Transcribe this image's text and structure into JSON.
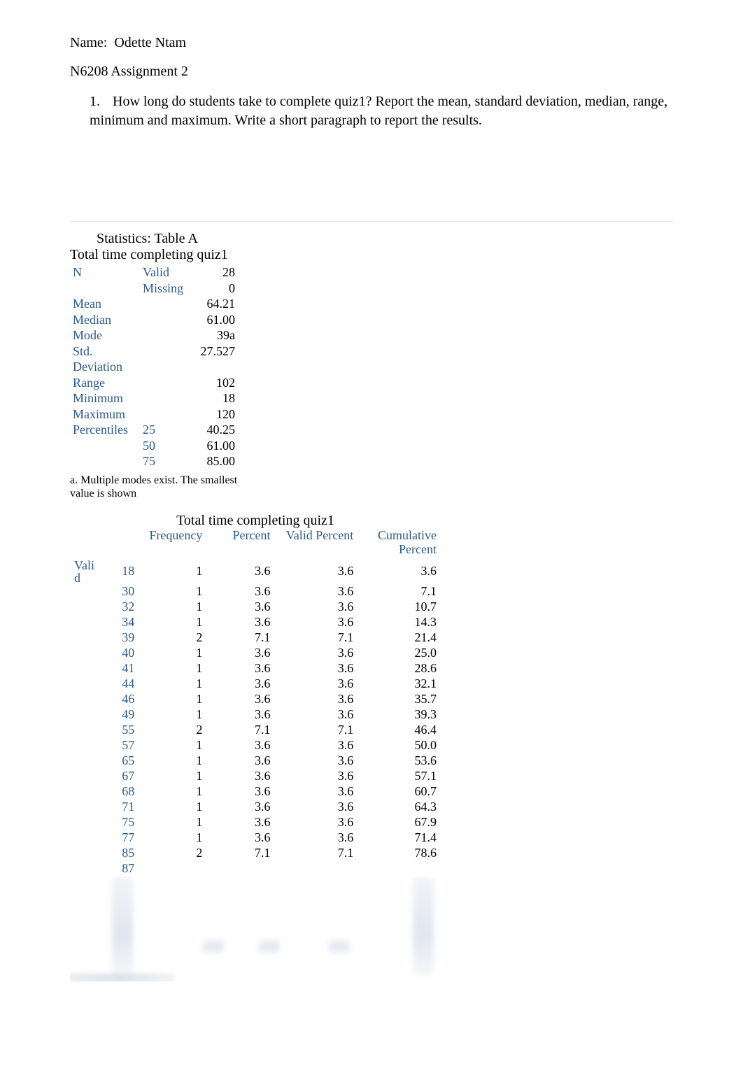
{
  "header": {
    "name_label": "Name:",
    "name_value": "Odette Ntam",
    "assignment": "N6208 Assignment 2",
    "q1_number": "1.",
    "q1_text": "How long do students take to complete quiz1? Report the mean, standard deviation, median, range, minimum and maximum. Write a short paragraph to report the results."
  },
  "stats": {
    "title": "Statistics: Table A",
    "subtitle": "Total time completing quiz1",
    "rows": [
      {
        "c0": "N",
        "c1": "Valid",
        "c2": "28"
      },
      {
        "c0": "",
        "c1": "Missing",
        "c2": "0"
      },
      {
        "c0": "Mean",
        "c1": "",
        "c2": "64.21"
      },
      {
        "c0": "Median",
        "c1": "",
        "c2": "61.00"
      },
      {
        "c0": "Mode",
        "c1": "",
        "c2": "39a"
      },
      {
        "c0": "Std. Deviation",
        "c1": "",
        "c2": "27.527"
      },
      {
        "c0": "Range",
        "c1": "",
        "c2": "102"
      },
      {
        "c0": "Minimum",
        "c1": "",
        "c2": "18"
      },
      {
        "c0": "Maximum",
        "c1": "",
        "c2": "120"
      },
      {
        "c0": "Percentiles",
        "c1": "25",
        "c2": "40.25"
      },
      {
        "c0": "",
        "c1": "50",
        "c2": "61.00"
      },
      {
        "c0": "",
        "c1": "75",
        "c2": "85.00"
      }
    ],
    "footnote": "a. Multiple modes exist. The smallest value is shown"
  },
  "freq": {
    "title": "Total time completing quiz1",
    "headers": {
      "group": "",
      "cat": "",
      "freq": "Frequency",
      "pct": "Percent",
      "vpct": "Valid Percent",
      "cpct": "Cumulative Percent"
    },
    "group_label": "Valid",
    "rows": [
      {
        "cat": "18",
        "freq": "1",
        "pct": "3.6",
        "vpct": "3.6",
        "cpct": "3.6"
      },
      {
        "cat": "30",
        "freq": "1",
        "pct": "3.6",
        "vpct": "3.6",
        "cpct": "7.1"
      },
      {
        "cat": "32",
        "freq": "1",
        "pct": "3.6",
        "vpct": "3.6",
        "cpct": "10.7"
      },
      {
        "cat": "34",
        "freq": "1",
        "pct": "3.6",
        "vpct": "3.6",
        "cpct": "14.3"
      },
      {
        "cat": "39",
        "freq": "2",
        "pct": "7.1",
        "vpct": "7.1",
        "cpct": "21.4"
      },
      {
        "cat": "40",
        "freq": "1",
        "pct": "3.6",
        "vpct": "3.6",
        "cpct": "25.0"
      },
      {
        "cat": "41",
        "freq": "1",
        "pct": "3.6",
        "vpct": "3.6",
        "cpct": "28.6"
      },
      {
        "cat": "44",
        "freq": "1",
        "pct": "3.6",
        "vpct": "3.6",
        "cpct": "32.1"
      },
      {
        "cat": "46",
        "freq": "1",
        "pct": "3.6",
        "vpct": "3.6",
        "cpct": "35.7"
      },
      {
        "cat": "49",
        "freq": "1",
        "pct": "3.6",
        "vpct": "3.6",
        "cpct": "39.3"
      },
      {
        "cat": "55",
        "freq": "2",
        "pct": "7.1",
        "vpct": "7.1",
        "cpct": "46.4"
      },
      {
        "cat": "57",
        "freq": "1",
        "pct": "3.6",
        "vpct": "3.6",
        "cpct": "50.0"
      },
      {
        "cat": "65",
        "freq": "1",
        "pct": "3.6",
        "vpct": "3.6",
        "cpct": "53.6"
      },
      {
        "cat": "67",
        "freq": "1",
        "pct": "3.6",
        "vpct": "3.6",
        "cpct": "57.1"
      },
      {
        "cat": "68",
        "freq": "1",
        "pct": "3.6",
        "vpct": "3.6",
        "cpct": "60.7"
      },
      {
        "cat": "71",
        "freq": "1",
        "pct": "3.6",
        "vpct": "3.6",
        "cpct": "64.3"
      },
      {
        "cat": "75",
        "freq": "1",
        "pct": "3.6",
        "vpct": "3.6",
        "cpct": "67.9"
      },
      {
        "cat": "77",
        "freq": "1",
        "pct": "3.6",
        "vpct": "3.6",
        "cpct": "71.4"
      },
      {
        "cat": "85",
        "freq": "2",
        "pct": "7.1",
        "vpct": "7.1",
        "cpct": "78.6"
      },
      {
        "cat": "87",
        "freq": "",
        "pct": "",
        "vpct": "",
        "cpct": ""
      }
    ]
  },
  "chart_data": {
    "type": "table",
    "title": "Statistics: Table A — Total time completing quiz1",
    "descriptives": {
      "N_valid": 28,
      "N_missing": 0,
      "mean": 64.21,
      "median": 61.0,
      "mode": 39,
      "mode_note": "Multiple modes exist. The smallest value is shown",
      "std_deviation": 27.527,
      "range": 102,
      "minimum": 18,
      "maximum": 120,
      "percentiles": {
        "25": 40.25,
        "50": 61.0,
        "75": 85.0
      }
    },
    "frequency_table": {
      "variable": "Total time completing quiz1",
      "columns": [
        "value",
        "frequency",
        "percent",
        "valid_percent",
        "cumulative_percent"
      ],
      "rows": [
        [
          18,
          1,
          3.6,
          3.6,
          3.6
        ],
        [
          30,
          1,
          3.6,
          3.6,
          7.1
        ],
        [
          32,
          1,
          3.6,
          3.6,
          10.7
        ],
        [
          34,
          1,
          3.6,
          3.6,
          14.3
        ],
        [
          39,
          2,
          7.1,
          7.1,
          21.4
        ],
        [
          40,
          1,
          3.6,
          3.6,
          25.0
        ],
        [
          41,
          1,
          3.6,
          3.6,
          28.6
        ],
        [
          44,
          1,
          3.6,
          3.6,
          32.1
        ],
        [
          46,
          1,
          3.6,
          3.6,
          35.7
        ],
        [
          49,
          1,
          3.6,
          3.6,
          39.3
        ],
        [
          55,
          2,
          7.1,
          7.1,
          46.4
        ],
        [
          57,
          1,
          3.6,
          3.6,
          50.0
        ],
        [
          65,
          1,
          3.6,
          3.6,
          53.6
        ],
        [
          67,
          1,
          3.6,
          3.6,
          57.1
        ],
        [
          68,
          1,
          3.6,
          3.6,
          60.7
        ],
        [
          71,
          1,
          3.6,
          3.6,
          64.3
        ],
        [
          75,
          1,
          3.6,
          3.6,
          67.9
        ],
        [
          77,
          1,
          3.6,
          3.6,
          71.4
        ],
        [
          85,
          2,
          7.1,
          7.1,
          78.6
        ]
      ]
    }
  }
}
